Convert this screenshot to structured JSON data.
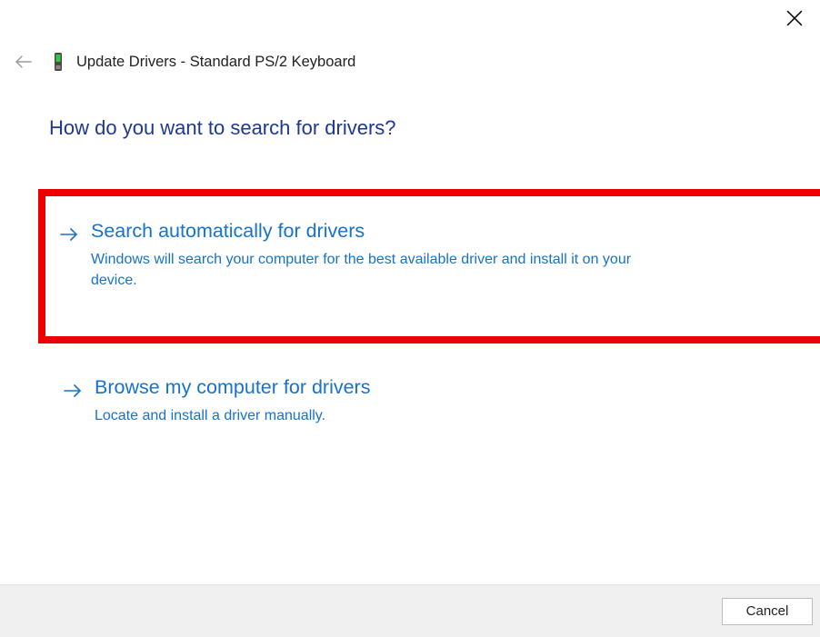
{
  "window": {
    "title_prefix": "Update Drivers",
    "device_name": "Standard PS/2 Keyboard"
  },
  "heading": "How do you want to search for drivers?",
  "options": [
    {
      "title": "Search automatically for drivers",
      "description": "Windows will search your computer for the best available driver and install it on your device.",
      "highlighted": true
    },
    {
      "title": "Browse my computer for drivers",
      "description": "Locate and install a driver manually.",
      "highlighted": false
    }
  ],
  "buttons": {
    "cancel": "Cancel"
  },
  "colors": {
    "link_blue": "#1773c9",
    "heading_blue": "#1e3894",
    "highlight_red": "#ee0000"
  }
}
